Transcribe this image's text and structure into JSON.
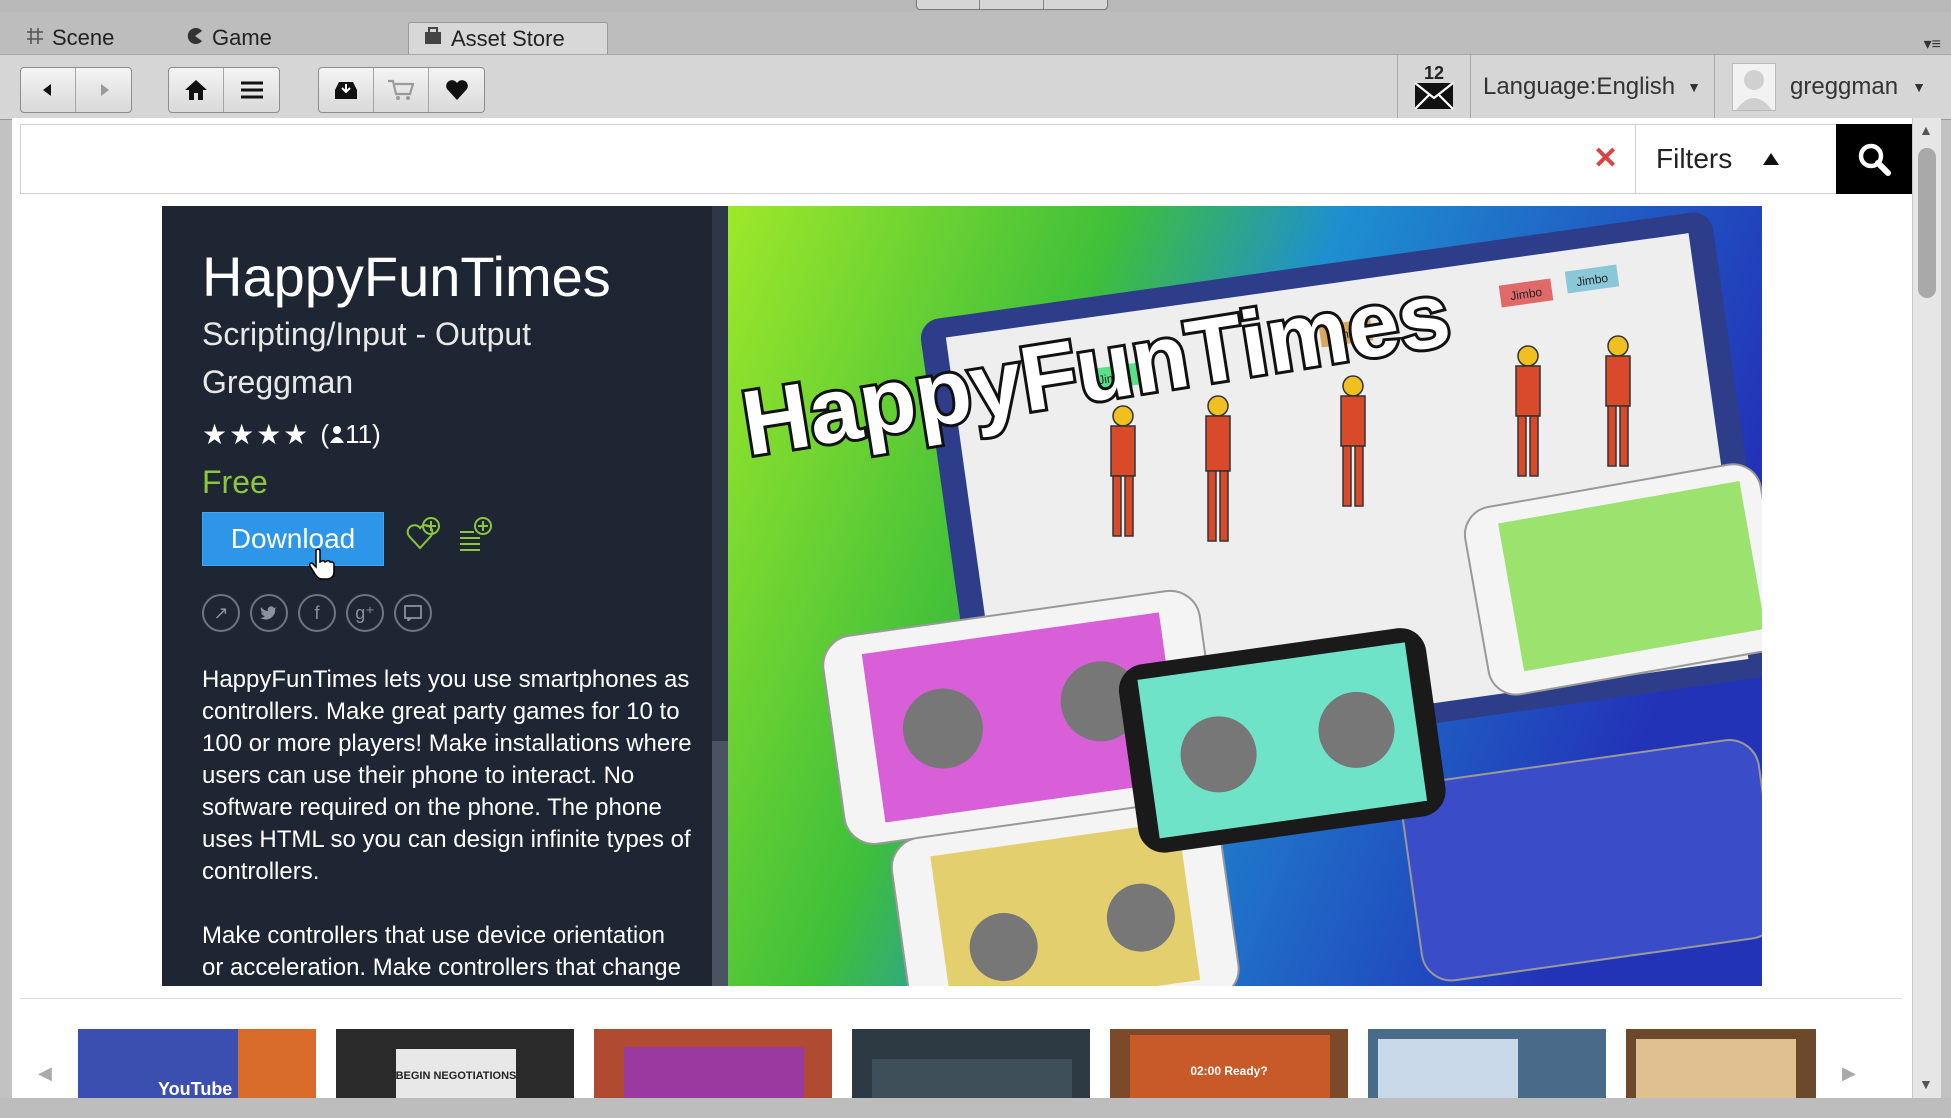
{
  "tabs": [
    {
      "label": "Scene",
      "icon": "grid-icon"
    },
    {
      "label": "Game",
      "icon": "pacman-icon"
    },
    {
      "label": "Asset Store",
      "icon": "store-icon"
    }
  ],
  "toolbar": {
    "mail_count": "12",
    "language": "Language:English",
    "username": "greggman"
  },
  "search": {
    "value": "",
    "clear_symbol": "✕",
    "filters_label": "Filters"
  },
  "asset": {
    "title": "HappyFunTimes",
    "category": "Scripting/Input - Output",
    "publisher": "Greggman",
    "stars": "★★★★",
    "rating_count": "11",
    "price": "Free",
    "download_label": "Download",
    "description": [
      "HappyFunTimes lets you use smartphones as controllers. Make great party games for 10 to 100 or more players! Make installations where users can use their phone to interact. No software required on the phone. The phone uses HTML so you can design infinite types of controllers.",
      "Make controllers that use device orientation or acceleration. Make controllers that change"
    ]
  },
  "hero_image": {
    "title_text": "HappyFunTimes",
    "name_tags": [
      "Jimbo",
      "Jimbo",
      "Jimbo",
      "Jimbo"
    ],
    "phone_colors": [
      "#d85fd8",
      "#6ee3c8",
      "#e3cf6e",
      "#9be36e",
      "#5f74d8"
    ]
  },
  "thumbnails": [
    {
      "caption": "YouTube",
      "color": "#3b4fb0"
    },
    {
      "caption": "BEGIN NEGOTIATIONS",
      "color": "#2a2a2a"
    },
    {
      "caption": "",
      "color": "#b04a30"
    },
    {
      "caption": "",
      "color": "#2d3a44"
    },
    {
      "caption": "02:00 Ready?",
      "color": "#7a4a2a"
    },
    {
      "caption": "",
      "color": "#4a6a8a"
    },
    {
      "caption": "",
      "color": "#6a4a2a"
    }
  ],
  "colors": {
    "panel_bg": "#1d2632",
    "accent": "#2d96e8",
    "price_green": "#8cc63f"
  }
}
